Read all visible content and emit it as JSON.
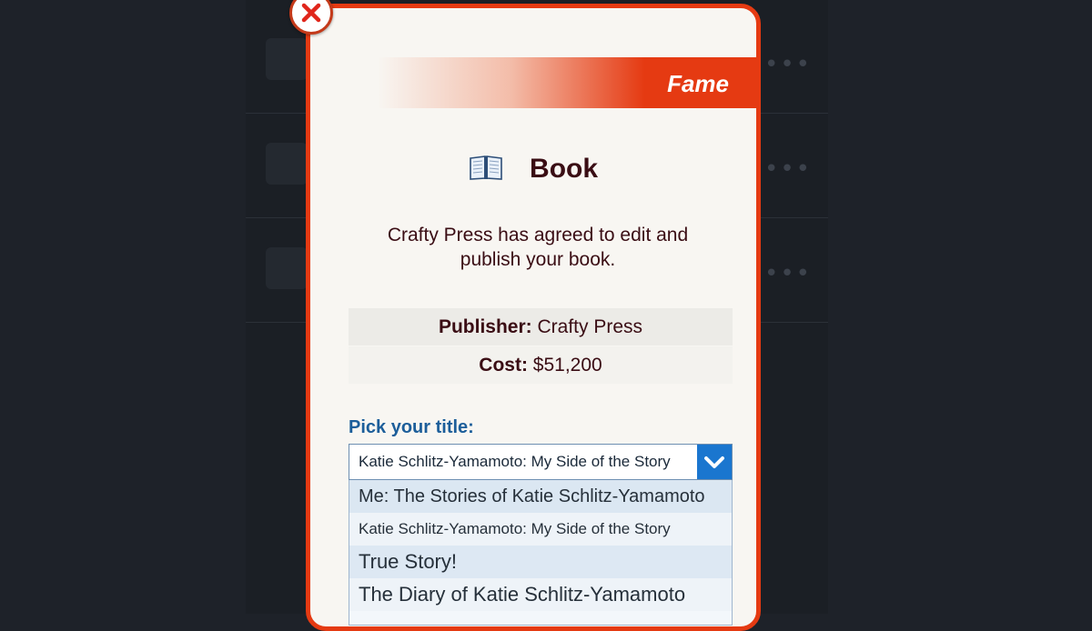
{
  "modal": {
    "category": "Fame",
    "title": "Book",
    "message": "Crafty Press has agreed to edit and publish your book.",
    "details": {
      "publisher_label": "Publisher:",
      "publisher_value": "Crafty Press",
      "cost_label": "Cost:",
      "cost_value": "$51,200"
    },
    "picker": {
      "label": "Pick your title:",
      "selected": "Katie Schlitz-Yamamoto: My Side of the Story",
      "options": [
        "Me: The Stories of Katie Schlitz-Yamamoto",
        "Katie Schlitz-Yamamoto: My Side of the Story",
        "True Story!",
        "The Diary of Katie Schlitz-Yamamoto"
      ]
    }
  },
  "background": {
    "rows": [
      {
        "icon": "clapperboard-icon"
      },
      {
        "icon": "camera-icon"
      },
      {
        "icon": "tv-icon"
      }
    ]
  },
  "icons": {
    "close": "close-icon",
    "title": "open-book-icon",
    "dropdown": "chevron-down-icon"
  },
  "colors": {
    "accent": "#e53a12",
    "select_button": "#1a76cf",
    "label_blue": "#1c5e9a",
    "title_text": "#3a0d14"
  }
}
